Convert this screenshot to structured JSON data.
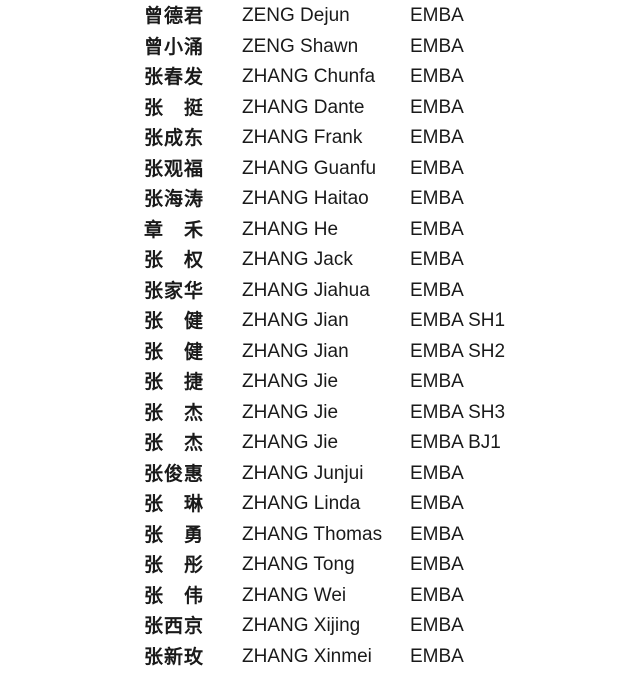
{
  "rows": [
    {
      "cn": "曾德君",
      "en": "ZENG Dejun",
      "program": "EMBA"
    },
    {
      "cn": "曾小涌",
      "en": "ZENG Shawn",
      "program": "EMBA"
    },
    {
      "cn": "张春发",
      "en": "ZHANG Chunfa",
      "program": "EMBA"
    },
    {
      "cn": "张　挺",
      "en": "ZHANG Dante",
      "program": "EMBA"
    },
    {
      "cn": "张成东",
      "en": "ZHANG Frank",
      "program": "EMBA"
    },
    {
      "cn": "张观福",
      "en": "ZHANG Guanfu",
      "program": "EMBA"
    },
    {
      "cn": "张海涛",
      "en": "ZHANG Haitao",
      "program": "EMBA"
    },
    {
      "cn": "章　禾",
      "en": "ZHANG He",
      "program": "EMBA"
    },
    {
      "cn": "张　权",
      "en": "ZHANG Jack",
      "program": "EMBA"
    },
    {
      "cn": "张家华",
      "en": "ZHANG Jiahua",
      "program": "EMBA"
    },
    {
      "cn": "张　健",
      "en": "ZHANG Jian",
      "program": "EMBA SH1"
    },
    {
      "cn": "张　健",
      "en": "ZHANG Jian",
      "program": "EMBA SH2"
    },
    {
      "cn": "张　捷",
      "en": "ZHANG Jie",
      "program": "EMBA"
    },
    {
      "cn": "张　杰",
      "en": "ZHANG Jie",
      "program": "EMBA SH3"
    },
    {
      "cn": "张　杰",
      "en": "ZHANG Jie",
      "program": "EMBA BJ1"
    },
    {
      "cn": "张俊惠",
      "en": "ZHANG Junjui",
      "program": "EMBA"
    },
    {
      "cn": "张　琳",
      "en": "ZHANG Linda",
      "program": "EMBA"
    },
    {
      "cn": "张　勇",
      "en": "ZHANG Thomas",
      "program": "EMBA"
    },
    {
      "cn": "张　彤",
      "en": "ZHANG Tong",
      "program": "EMBA"
    },
    {
      "cn": "张　伟",
      "en": "ZHANG Wei",
      "program": "EMBA"
    },
    {
      "cn": "张西京",
      "en": "ZHANG Xijing",
      "program": "EMBA"
    },
    {
      "cn": "张新玫",
      "en": "ZHANG Xinmei",
      "program": "EMBA"
    }
  ]
}
